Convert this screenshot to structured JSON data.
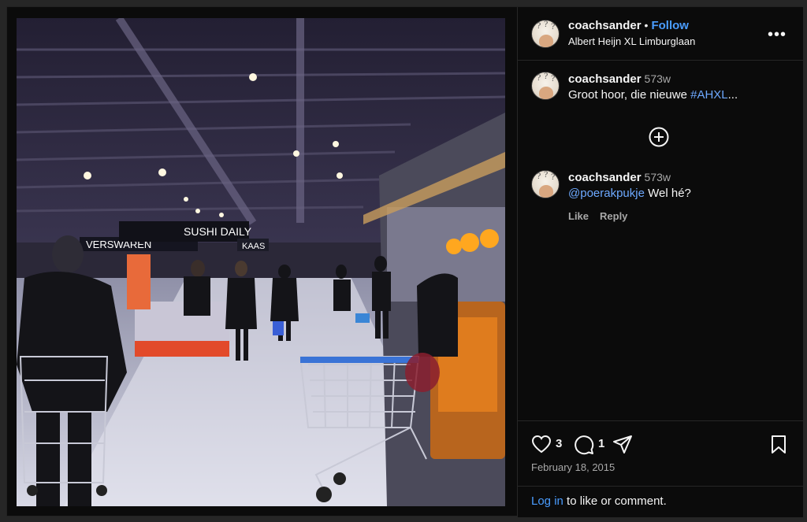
{
  "post": {
    "image_alt": "Supermarket aisle",
    "store_signs": [
      "VERSWAREN",
      "SUSHI DAILY",
      "KAAS"
    ]
  },
  "header": {
    "username": "coachsander",
    "separator": "•",
    "follow_label": "Follow",
    "location": "Albert Heijn XL Limburglaan",
    "more_label": "•••"
  },
  "comments": [
    {
      "username": "coachsander",
      "time": "573w",
      "text": "Groot hoor, die nieuwe ",
      "hashtag": "#AHXL",
      "ellipsis": "..."
    },
    {
      "username": "coachsander",
      "time": "573w",
      "mention": "@poerakpukje",
      "text": " Wel hé?",
      "like_label": "Like",
      "reply_label": "Reply"
    }
  ],
  "actions": {
    "likes": "3",
    "comments": "1",
    "date": "February 18, 2015"
  },
  "login": {
    "link": "Log in",
    "text": " to like or comment."
  },
  "colors": {
    "accent": "#4a9dff",
    "background": "#0b0b0b",
    "secondary_text": "#a8a8a8"
  }
}
